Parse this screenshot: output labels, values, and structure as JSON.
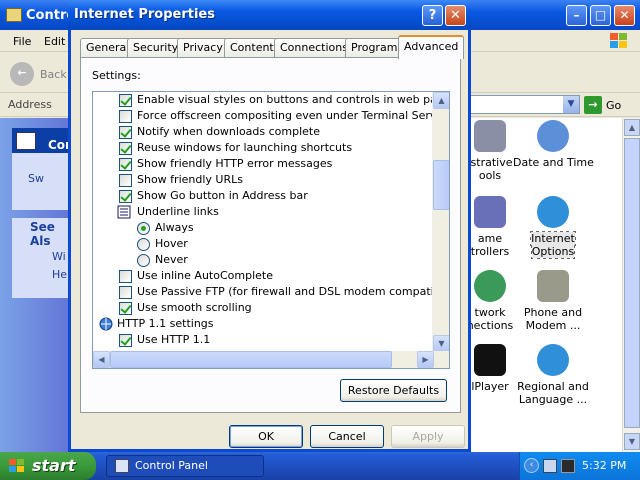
{
  "control_panel": {
    "title": "Control Panel",
    "menu": [
      "File",
      "Edit"
    ],
    "back_label": "Back",
    "address_label": "Address",
    "go_label": "Go",
    "left_pane": {
      "control_panel_head": "Con",
      "switch_link": "Sw",
      "see_also": "See Als",
      "links": [
        "Wi",
        "He"
      ]
    },
    "items": [
      {
        "label": "istrative\nools",
        "icon": "administrative-tools-icon"
      },
      {
        "label": "Date and Time",
        "icon": "date-time-icon"
      },
      {
        "label": "ame\ntrollers",
        "icon": "game-controllers-icon"
      },
      {
        "label": "Internet\nOptions",
        "icon": "internet-options-icon"
      },
      {
        "label": "twork\nnections",
        "icon": "network-connections-icon"
      },
      {
        "label": "Phone and\nModem ...",
        "icon": "phone-modem-icon"
      },
      {
        "label": "lPlayer",
        "icon": "realplayer-icon"
      },
      {
        "label": "Regional and\nLanguage ...",
        "icon": "regional-language-icon"
      }
    ]
  },
  "dialog": {
    "title": "Internet Properties",
    "help_glyph": "?",
    "close_glyph": "✕",
    "tabs": [
      "General",
      "Security",
      "Privacy",
      "Content",
      "Connections",
      "Programs",
      "Advanced"
    ],
    "active_tab": "Advanced",
    "settings_label": "Settings:",
    "settings": [
      {
        "type": "checkbox",
        "checked": true,
        "label": "Enable visual styles on buttons and controls in web pages"
      },
      {
        "type": "checkbox",
        "checked": false,
        "label": "Force offscreen compositing even under Terminal Server (requ"
      },
      {
        "type": "checkbox",
        "checked": true,
        "label": "Notify when downloads complete"
      },
      {
        "type": "checkbox",
        "checked": true,
        "label": "Reuse windows for launching shortcuts"
      },
      {
        "type": "checkbox",
        "checked": true,
        "label": "Show friendly HTTP error messages"
      },
      {
        "type": "checkbox",
        "checked": false,
        "label": "Show friendly URLs"
      },
      {
        "type": "checkbox",
        "checked": true,
        "label": "Show Go button in Address bar"
      },
      {
        "type": "group",
        "label": "Underline links"
      },
      {
        "type": "radio",
        "checked": true,
        "label": "Always"
      },
      {
        "type": "radio",
        "checked": false,
        "label": "Hover"
      },
      {
        "type": "radio",
        "checked": false,
        "label": "Never"
      },
      {
        "type": "checkbox",
        "checked": false,
        "label": "Use inline AutoComplete"
      },
      {
        "type": "checkbox",
        "checked": false,
        "label": "Use Passive FTP (for firewall and DSL modem compatibility)"
      },
      {
        "type": "checkbox",
        "checked": true,
        "label": "Use smooth scrolling"
      },
      {
        "type": "group",
        "label": "HTTP 1.1 settings"
      },
      {
        "type": "checkbox",
        "checked": true,
        "label": "Use HTTP 1.1"
      }
    ],
    "restore_defaults": "Restore Defaults",
    "ok": "OK",
    "cancel": "Cancel",
    "apply": "Apply"
  },
  "taskbar": {
    "start_label": "start",
    "task_button": "Control Panel",
    "clock": "5:32 PM"
  }
}
